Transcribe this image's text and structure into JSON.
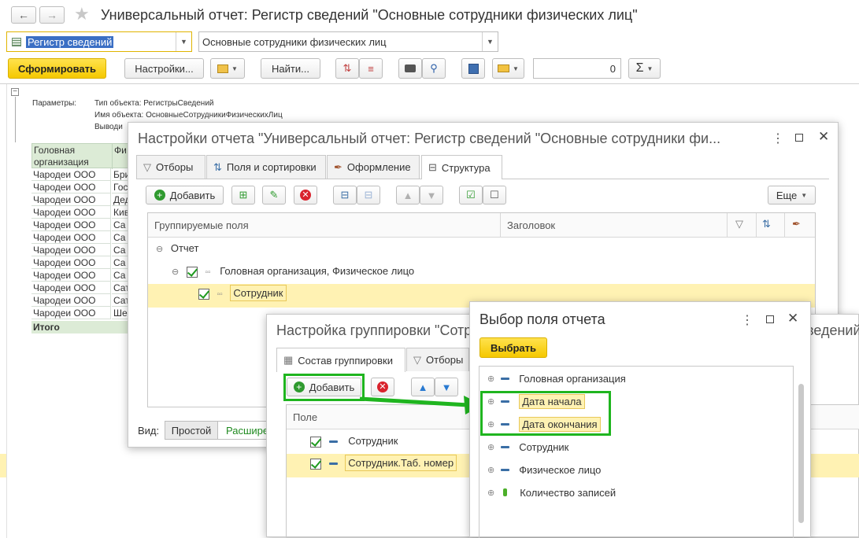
{
  "window": {
    "title": "Универсальный отчет: Регистр сведений \"Основные сотрудники физических лиц\"",
    "object_type_value": "Регистр сведений",
    "object_name_value": "Основные сотрудники физических лиц"
  },
  "toolbar": {
    "generate_label": "Сформировать",
    "settings_label": "Настройки...",
    "find_label": "Найти...",
    "sum_value": "0",
    "sigma": "Σ"
  },
  "report": {
    "params_label": "Параметры:",
    "param_lines": [
      "Тип объекта: РегистрыСведений",
      "Имя объекта: ОсновныеСотрудникиФизическихЛиц",
      "Выводи"
    ],
    "header_col1": [
      "Головная",
      "организация"
    ],
    "header_col2": "Фи",
    "rows": [
      [
        "Чародеи ООО",
        "Бри"
      ],
      [
        "Чародеи ООО",
        "Гос"
      ],
      [
        "Чародеи ООО",
        "Дед"
      ],
      [
        "Чародеи ООО",
        "Кив"
      ],
      [
        "Чародеи ООО",
        "Са"
      ],
      [
        "Чародеи ООО",
        "Са"
      ],
      [
        "Чародеи ООО",
        "Са"
      ],
      [
        "Чародеи ООО",
        "Са"
      ],
      [
        "Чародеи ООО",
        "Са"
      ],
      [
        "Чародеи ООО",
        "Сат"
      ],
      [
        "Чародеи ООО",
        "Сат"
      ],
      [
        "Чародеи ООО",
        "Шее"
      ]
    ],
    "total_label": "Итого"
  },
  "settings_dialog": {
    "title": "Настройки отчета \"Универсальный отчет: Регистр сведений \"Основные сотрудники фи...",
    "tabs": [
      "Отборы",
      "Поля и сортировки",
      "Оформление",
      "Структура"
    ],
    "add_label": "Добавить",
    "more_label": "Еще",
    "col_grouped": "Группируемые поля",
    "col_header": "Заголовок",
    "tree": {
      "root": "Отчет",
      "level1": "Головная организация, Физическое лицо",
      "level2": "Сотрудник"
    },
    "view_label": "Вид:",
    "view_simple": "Простой",
    "view_extended": "Расшире"
  },
  "grouping_dialog": {
    "title": "Настройка группировки \"Сотр",
    "title_tail": "ведений",
    "tabs": [
      "Состав группировки",
      "Отборы"
    ],
    "add_label": "Добавить",
    "col_field": "Поле",
    "fields": [
      "Сотрудник",
      "Сотрудник.Таб. номер"
    ]
  },
  "select_dialog": {
    "title": "Выбор поля отчета",
    "select_label": "Выбрать",
    "fields": [
      "Головная организация",
      "Дата начала",
      "Дата окончания",
      "Сотрудник",
      "Физическое лицо",
      "Количество записей"
    ]
  },
  "colors": {
    "accent_yellow": "#f5c800",
    "highlight_green": "#1fb51f",
    "header_green": "#dcebd6"
  }
}
